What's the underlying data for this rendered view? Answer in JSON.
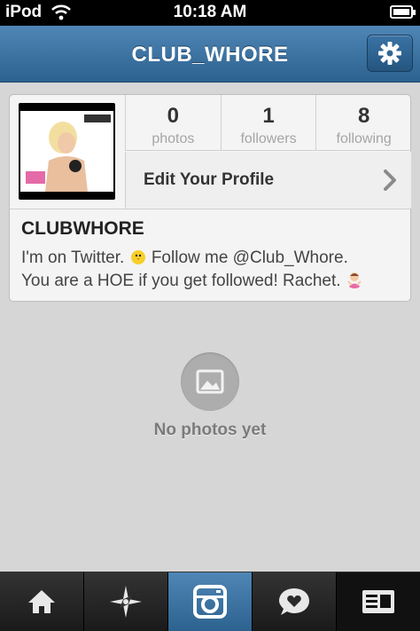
{
  "status_bar": {
    "carrier": "iPod",
    "time": "10:18 AM"
  },
  "nav": {
    "title": "CLUB_WHORE",
    "settings_icon": "gear-icon"
  },
  "profile": {
    "stats": [
      {
        "value": "0",
        "label": "photos"
      },
      {
        "value": "1",
        "label": "followers"
      },
      {
        "value": "8",
        "label": "following"
      }
    ],
    "edit_label": "Edit Your Profile",
    "username": "CLUBWHORE",
    "bio_line1_a": "I'm on Twitter.",
    "bio_line1_b": "Follow me @Club_Whore.",
    "bio_line2": "You are a HOE if you get followed! Rachet."
  },
  "empty_state": {
    "text": "No photos yet",
    "icon": "photo-icon"
  },
  "tabbar": {
    "items": [
      "home-icon",
      "explore-star-icon",
      "camera-icon",
      "news-bubble-icon",
      "profile-card-icon"
    ],
    "active": "camera-icon"
  },
  "colors": {
    "nav_blue": "#3b73a5",
    "background": "#d6d6d6"
  }
}
